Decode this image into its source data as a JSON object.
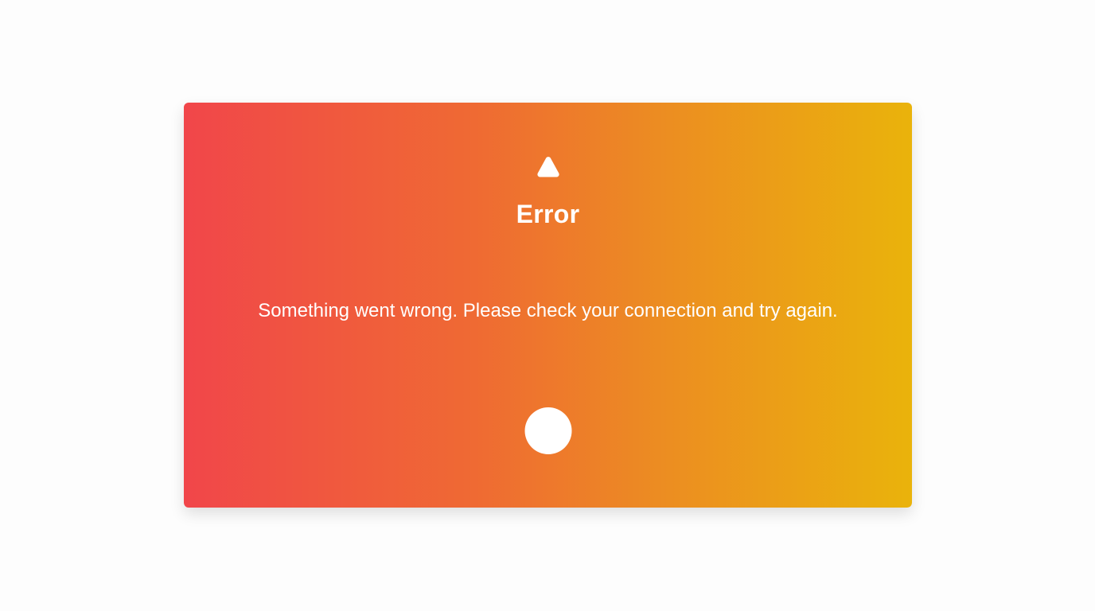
{
  "error_card": {
    "icon": "warning-triangle-icon",
    "title": "Error",
    "message": "Something went wrong. Please check your connection and try again.",
    "action_icon": "circle-action-icon",
    "colors": {
      "gradient_start": "#f1464a",
      "gradient_mid": "#ec8c22",
      "gradient_end": "#eab30b",
      "text": "#ffffff",
      "page_background": "#fdfdfd"
    }
  }
}
